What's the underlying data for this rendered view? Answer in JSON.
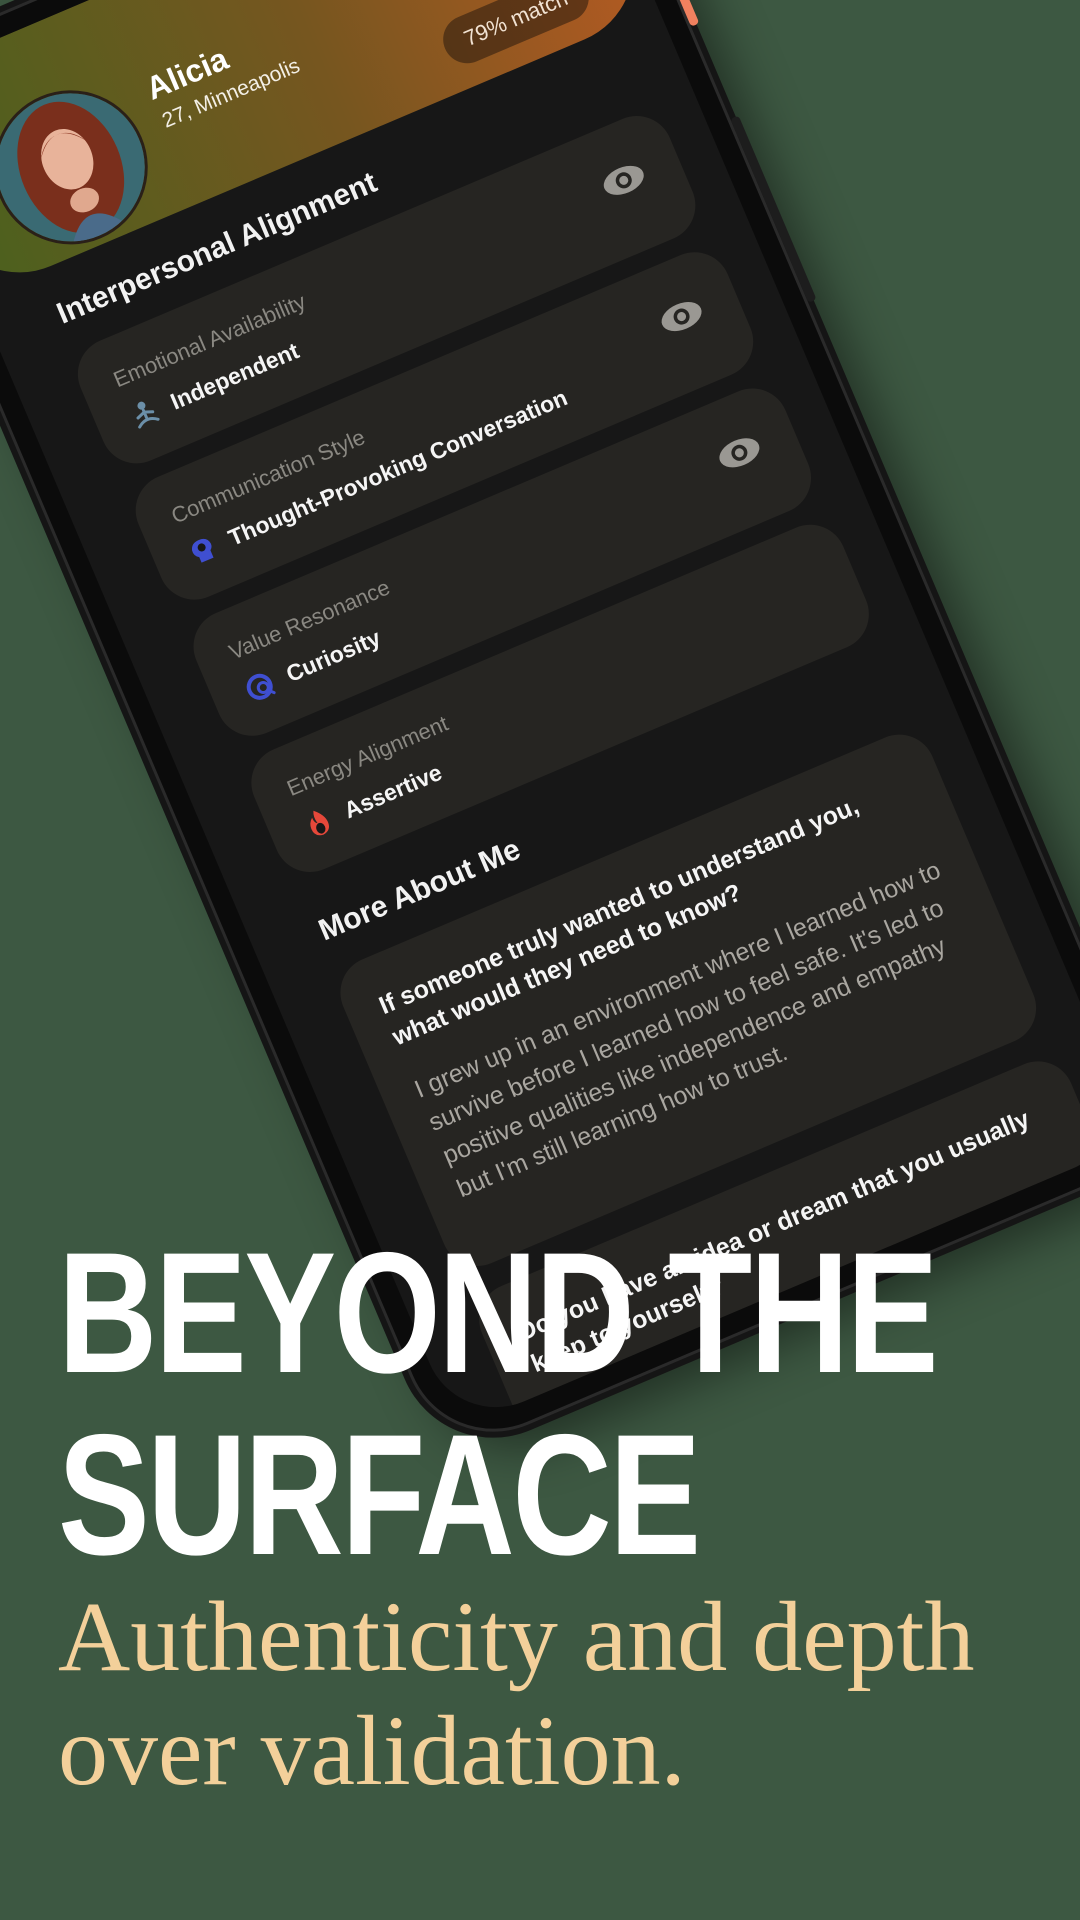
{
  "profile": {
    "name": "Alicia",
    "subtitle": "27, Minneapolis",
    "match_badge": "79% match"
  },
  "interpersonal": {
    "title": "Interpersonal Alignment",
    "cards": [
      {
        "label": "Emotional Availability",
        "value": "Independent",
        "icon": "meditation-icon"
      },
      {
        "label": "Communication Style",
        "value": "Thought-Provoking Conversation",
        "icon": "brain-icon"
      },
      {
        "label": "Value Resonance",
        "value": "Curiosity",
        "icon": "magnifier-icon"
      },
      {
        "label": "Energy Alignment",
        "value": "Assertive",
        "icon": "flame-icon"
      }
    ]
  },
  "more_about": {
    "title": "More About Me",
    "items": [
      {
        "question": "If someone truly wanted to understand you, what would they need to know?",
        "answer": "I grew up in an environment where I learned how to survive before I learned how to feel safe. It's led to positive qualities like independence and empathy but I'm still learning how to trust."
      },
      {
        "question": "Do you have an idea or dream that you usually keep to yourself?",
        "answer": ""
      }
    ]
  },
  "headline": "BEYOND THE\nSURFACE",
  "tagline": "Authenticity and depth\nover validation.",
  "colors": {
    "background": "#3d5842",
    "headline": "#ffffff",
    "tagline": "#f3d09a",
    "accent_power_button": "#f0815f"
  }
}
